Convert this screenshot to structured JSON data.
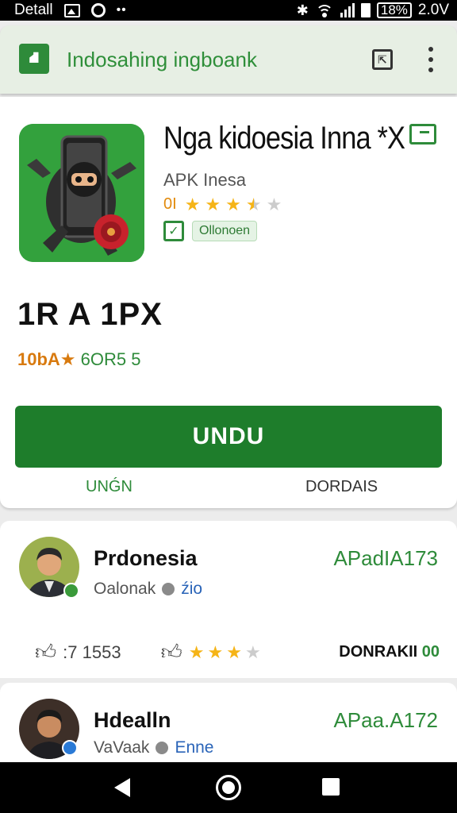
{
  "status_bar": {
    "carrier": "Detall",
    "battery_percent": "18%",
    "time": "2.0V",
    "icons": [
      "image-icon",
      "sync-icon",
      "more-dots-icon",
      "bluetooth-icon",
      "wifi-icon",
      "signal-icon",
      "battery-icon"
    ]
  },
  "app_bar": {
    "title": "Indosahing ingboank",
    "icons": [
      "store-logo-icon",
      "open-external-icon",
      "more-vert-icon"
    ]
  },
  "app": {
    "name": "Nga kidoesia Inna *X",
    "developer": "APK Inesa",
    "rating_text": "0I",
    "rating_stars": 3.5,
    "badge": "Ollonoen",
    "price": "1R A 1PX",
    "meta_rating": "10bA★",
    "meta_extra": "6OR5 5",
    "install_label": "UNDU",
    "tab_left": "UNǴN",
    "tab_right": "DORDAIS"
  },
  "reviews": [
    {
      "name": "Prdonesia",
      "subtitle": "Oalonak",
      "location": "źio",
      "right_label": "APadIA173",
      "count": ":7 1553",
      "stars": 3,
      "action": "DONRAKII",
      "action_num": "00"
    },
    {
      "name": "Hdealln",
      "subtitle": "VaVaak",
      "location": "Enne",
      "right_label": "APaa.A172"
    }
  ],
  "colors": {
    "brand_green": "#2e8b3a",
    "install_green": "#1e7d2b",
    "star_gold": "#f5b417",
    "rating_orange": "#e28a0c"
  },
  "nav_bar": {
    "icons": [
      "back-icon",
      "home-icon",
      "recents-icon"
    ]
  }
}
